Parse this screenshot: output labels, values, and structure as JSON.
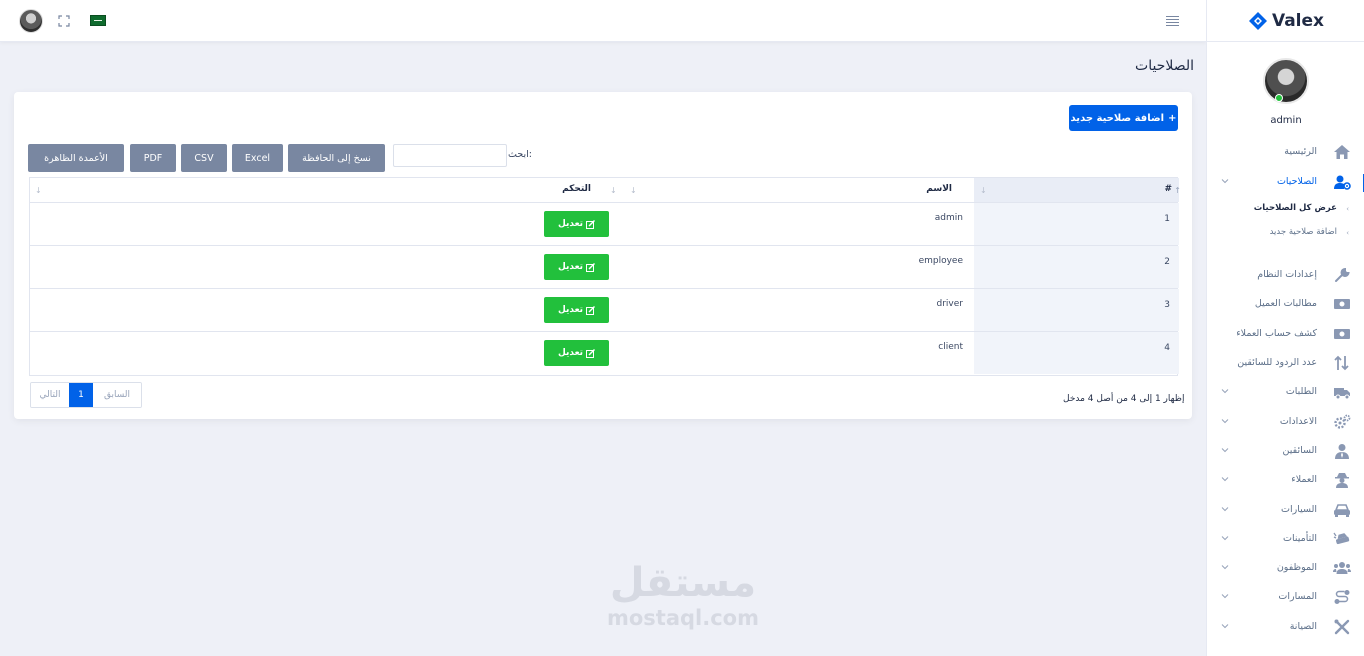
{
  "header": {
    "avatar": "user-avatar",
    "fullscreen_icon": "fullscreen-icon",
    "flag_icon": "saudi-flag-icon",
    "menu_icon": "hamburger-menu-icon"
  },
  "sidebar": {
    "brand": "Valex",
    "user_name": "admin",
    "items": [
      {
        "label": "الرئيسية",
        "icon": "home-icon"
      },
      {
        "label": "الصلاحيات",
        "icon": "user-cog-icon",
        "active": true
      },
      {
        "label": "عرض كل الصلاحيات"
      },
      {
        "label": "اضافة صلاحية جديد"
      },
      {
        "label": "إعدادات النظام",
        "icon": "wrench-icon"
      },
      {
        "label": "مطالبات العميل",
        "icon": "money-icon"
      },
      {
        "label": "كشف حساب العملاء",
        "icon": "money-icon"
      },
      {
        "label": "عدد الردود للسائقين",
        "icon": "sort-icon"
      },
      {
        "label": "الطلبات",
        "icon": "truck-icon"
      },
      {
        "label": "الاعدادات",
        "icon": "cogs-icon"
      },
      {
        "label": "السائقين",
        "icon": "user-tie-icon"
      },
      {
        "label": "العملاء",
        "icon": "user-secret-icon"
      },
      {
        "label": "السيارات",
        "icon": "car-icon"
      },
      {
        "label": "التأمينات",
        "icon": "car-crash-icon"
      },
      {
        "label": "الموظفون",
        "icon": "users-icon"
      },
      {
        "label": "المسارات",
        "icon": "route-icon"
      },
      {
        "label": "الصيانة",
        "icon": "tools-icon"
      }
    ]
  },
  "page": {
    "title": "الصلاحيات"
  },
  "toolbar": {
    "add_label": "اضافة صلاحية جديد",
    "search_label": "ابحث:",
    "search_value": "",
    "buttons": [
      "الأعمدة الظاهرة",
      "PDF",
      "CSV",
      "Excel",
      "نسخ إلى الحافظة"
    ]
  },
  "table": {
    "headers": [
      "#",
      "الاسم",
      "التحكم"
    ],
    "edit_label": "تعديل",
    "rows": [
      {
        "num": "1",
        "name": "admin"
      },
      {
        "num": "2",
        "name": "employee"
      },
      {
        "num": "3",
        "name": "driver"
      },
      {
        "num": "4",
        "name": "client"
      }
    ]
  },
  "footer": {
    "info": "إظهار 1 إلى 4 من أصل 4 مدخل",
    "prev": "السابق",
    "page": "1",
    "next": "التالي"
  },
  "watermark": {
    "arabic": "مستقل",
    "latin": "mostaql.com"
  },
  "colors": {
    "primary": "#0162e8",
    "success": "#22c03c",
    "secondary": "#7987a1",
    "background": "#eef0f7"
  }
}
